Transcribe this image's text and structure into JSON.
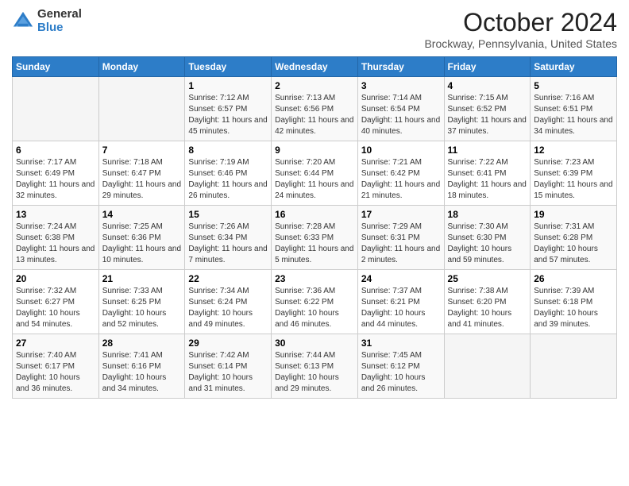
{
  "logo": {
    "general": "General",
    "blue": "Blue"
  },
  "header": {
    "title": "October 2024",
    "subtitle": "Brockway, Pennsylvania, United States"
  },
  "days_of_week": [
    "Sunday",
    "Monday",
    "Tuesday",
    "Wednesday",
    "Thursday",
    "Friday",
    "Saturday"
  ],
  "weeks": [
    [
      {
        "day": "",
        "sunrise": "",
        "sunset": "",
        "daylight": ""
      },
      {
        "day": "",
        "sunrise": "",
        "sunset": "",
        "daylight": ""
      },
      {
        "day": "1",
        "sunrise": "Sunrise: 7:12 AM",
        "sunset": "Sunset: 6:57 PM",
        "daylight": "Daylight: 11 hours and 45 minutes."
      },
      {
        "day": "2",
        "sunrise": "Sunrise: 7:13 AM",
        "sunset": "Sunset: 6:56 PM",
        "daylight": "Daylight: 11 hours and 42 minutes."
      },
      {
        "day": "3",
        "sunrise": "Sunrise: 7:14 AM",
        "sunset": "Sunset: 6:54 PM",
        "daylight": "Daylight: 11 hours and 40 minutes."
      },
      {
        "day": "4",
        "sunrise": "Sunrise: 7:15 AM",
        "sunset": "Sunset: 6:52 PM",
        "daylight": "Daylight: 11 hours and 37 minutes."
      },
      {
        "day": "5",
        "sunrise": "Sunrise: 7:16 AM",
        "sunset": "Sunset: 6:51 PM",
        "daylight": "Daylight: 11 hours and 34 minutes."
      }
    ],
    [
      {
        "day": "6",
        "sunrise": "Sunrise: 7:17 AM",
        "sunset": "Sunset: 6:49 PM",
        "daylight": "Daylight: 11 hours and 32 minutes."
      },
      {
        "day": "7",
        "sunrise": "Sunrise: 7:18 AM",
        "sunset": "Sunset: 6:47 PM",
        "daylight": "Daylight: 11 hours and 29 minutes."
      },
      {
        "day": "8",
        "sunrise": "Sunrise: 7:19 AM",
        "sunset": "Sunset: 6:46 PM",
        "daylight": "Daylight: 11 hours and 26 minutes."
      },
      {
        "day": "9",
        "sunrise": "Sunrise: 7:20 AM",
        "sunset": "Sunset: 6:44 PM",
        "daylight": "Daylight: 11 hours and 24 minutes."
      },
      {
        "day": "10",
        "sunrise": "Sunrise: 7:21 AM",
        "sunset": "Sunset: 6:42 PM",
        "daylight": "Daylight: 11 hours and 21 minutes."
      },
      {
        "day": "11",
        "sunrise": "Sunrise: 7:22 AM",
        "sunset": "Sunset: 6:41 PM",
        "daylight": "Daylight: 11 hours and 18 minutes."
      },
      {
        "day": "12",
        "sunrise": "Sunrise: 7:23 AM",
        "sunset": "Sunset: 6:39 PM",
        "daylight": "Daylight: 11 hours and 15 minutes."
      }
    ],
    [
      {
        "day": "13",
        "sunrise": "Sunrise: 7:24 AM",
        "sunset": "Sunset: 6:38 PM",
        "daylight": "Daylight: 11 hours and 13 minutes."
      },
      {
        "day": "14",
        "sunrise": "Sunrise: 7:25 AM",
        "sunset": "Sunset: 6:36 PM",
        "daylight": "Daylight: 11 hours and 10 minutes."
      },
      {
        "day": "15",
        "sunrise": "Sunrise: 7:26 AM",
        "sunset": "Sunset: 6:34 PM",
        "daylight": "Daylight: 11 hours and 7 minutes."
      },
      {
        "day": "16",
        "sunrise": "Sunrise: 7:28 AM",
        "sunset": "Sunset: 6:33 PM",
        "daylight": "Daylight: 11 hours and 5 minutes."
      },
      {
        "day": "17",
        "sunrise": "Sunrise: 7:29 AM",
        "sunset": "Sunset: 6:31 PM",
        "daylight": "Daylight: 11 hours and 2 minutes."
      },
      {
        "day": "18",
        "sunrise": "Sunrise: 7:30 AM",
        "sunset": "Sunset: 6:30 PM",
        "daylight": "Daylight: 10 hours and 59 minutes."
      },
      {
        "day": "19",
        "sunrise": "Sunrise: 7:31 AM",
        "sunset": "Sunset: 6:28 PM",
        "daylight": "Daylight: 10 hours and 57 minutes."
      }
    ],
    [
      {
        "day": "20",
        "sunrise": "Sunrise: 7:32 AM",
        "sunset": "Sunset: 6:27 PM",
        "daylight": "Daylight: 10 hours and 54 minutes."
      },
      {
        "day": "21",
        "sunrise": "Sunrise: 7:33 AM",
        "sunset": "Sunset: 6:25 PM",
        "daylight": "Daylight: 10 hours and 52 minutes."
      },
      {
        "day": "22",
        "sunrise": "Sunrise: 7:34 AM",
        "sunset": "Sunset: 6:24 PM",
        "daylight": "Daylight: 10 hours and 49 minutes."
      },
      {
        "day": "23",
        "sunrise": "Sunrise: 7:36 AM",
        "sunset": "Sunset: 6:22 PM",
        "daylight": "Daylight: 10 hours and 46 minutes."
      },
      {
        "day": "24",
        "sunrise": "Sunrise: 7:37 AM",
        "sunset": "Sunset: 6:21 PM",
        "daylight": "Daylight: 10 hours and 44 minutes."
      },
      {
        "day": "25",
        "sunrise": "Sunrise: 7:38 AM",
        "sunset": "Sunset: 6:20 PM",
        "daylight": "Daylight: 10 hours and 41 minutes."
      },
      {
        "day": "26",
        "sunrise": "Sunrise: 7:39 AM",
        "sunset": "Sunset: 6:18 PM",
        "daylight": "Daylight: 10 hours and 39 minutes."
      }
    ],
    [
      {
        "day": "27",
        "sunrise": "Sunrise: 7:40 AM",
        "sunset": "Sunset: 6:17 PM",
        "daylight": "Daylight: 10 hours and 36 minutes."
      },
      {
        "day": "28",
        "sunrise": "Sunrise: 7:41 AM",
        "sunset": "Sunset: 6:16 PM",
        "daylight": "Daylight: 10 hours and 34 minutes."
      },
      {
        "day": "29",
        "sunrise": "Sunrise: 7:42 AM",
        "sunset": "Sunset: 6:14 PM",
        "daylight": "Daylight: 10 hours and 31 minutes."
      },
      {
        "day": "30",
        "sunrise": "Sunrise: 7:44 AM",
        "sunset": "Sunset: 6:13 PM",
        "daylight": "Daylight: 10 hours and 29 minutes."
      },
      {
        "day": "31",
        "sunrise": "Sunrise: 7:45 AM",
        "sunset": "Sunset: 6:12 PM",
        "daylight": "Daylight: 10 hours and 26 minutes."
      },
      {
        "day": "",
        "sunrise": "",
        "sunset": "",
        "daylight": ""
      },
      {
        "day": "",
        "sunrise": "",
        "sunset": "",
        "daylight": ""
      }
    ]
  ]
}
